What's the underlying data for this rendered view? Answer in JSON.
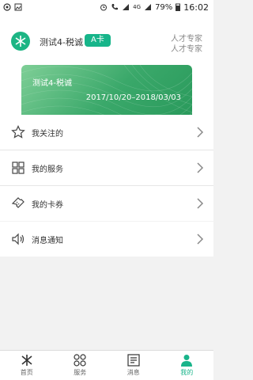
{
  "status": {
    "battery": "79%",
    "time": "16:02",
    "network": "4G"
  },
  "profile": {
    "name": "测试4-税诚",
    "badge": "A卡",
    "roles": [
      "人才专家",
      "人才专家"
    ]
  },
  "card": {
    "name": "测试4-税诚",
    "validity": "2017/10/20–2018/03/03"
  },
  "menu_group1": [
    {
      "label": "我关注的",
      "icon": "star-icon"
    },
    {
      "label": "我的服务",
      "icon": "grid-icon"
    },
    {
      "label": "我的卡券",
      "icon": "ticket-icon"
    }
  ],
  "menu_group2": [
    {
      "label": "消息通知",
      "icon": "speaker-icon"
    }
  ],
  "tabs": [
    {
      "label": "首页",
      "icon": "home-logo-icon",
      "active": false
    },
    {
      "label": "服务",
      "icon": "service-icon",
      "active": false
    },
    {
      "label": "消息",
      "icon": "news-icon",
      "active": false
    },
    {
      "label": "我的",
      "icon": "profile-icon",
      "active": true
    }
  ],
  "colors": {
    "accent": "#19b48a",
    "card": "#3aa86a"
  }
}
